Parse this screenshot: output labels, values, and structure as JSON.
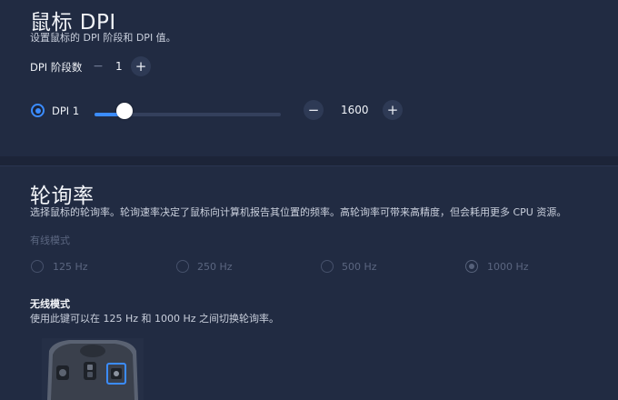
{
  "dpi_section": {
    "title": "鼠标 DPI",
    "description": "设置鼠标的 DPI 阶段和 DPI 值。",
    "stage_count_label": "DPI 阶段数",
    "stage_count_minus": "−",
    "stage_count_value": "1",
    "stage_count_plus": "+",
    "dpi_item_label": "DPI 1",
    "dpi_value": "1600",
    "dpi_minus": "−",
    "dpi_plus": "+",
    "slider_fraction": 0.1
  },
  "polling_section": {
    "title": "轮询率",
    "description": "选择鼠标的轮询率。轮询速率决定了鼠标向计算机报告其位置的频率。高轮询率可带来高精度，但会耗用更多 CPU 资源。",
    "wired_mode_label": "有线模式",
    "options": [
      "125 Hz",
      "250 Hz",
      "500 Hz",
      "1000 Hz"
    ],
    "selected_option": "1000 Hz",
    "wireless_mode_label": "无线模式",
    "wireless_mode_description": "使用此键可以在 125 Hz 和 1000 Hz 之间切换轮询率。"
  },
  "colors": {
    "accent": "#3b8cff",
    "background": "#1c2438",
    "card": "#212b42"
  }
}
